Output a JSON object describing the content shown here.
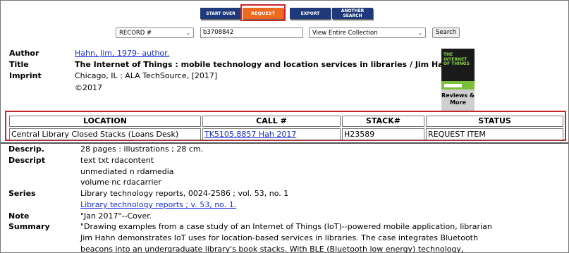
{
  "toolbar": {
    "start_over": "Start Over",
    "request": "Request",
    "export": "Export",
    "another_search": "Another Search"
  },
  "search": {
    "field_select": "RECORD #",
    "query_value": "b3708842",
    "scope_select": "View Entire Collection",
    "search_button": "Search"
  },
  "bib": {
    "author_label": "Author",
    "author_value": "Hahn, Jim, 1979- author.",
    "title_label": "Title",
    "title_value": "The Internet of Things : mobile technology and location services in libraries / Jim Hahn.",
    "imprint_label": "Imprint",
    "imprint_value": "Chicago, IL : ALA TechSource, [2017]",
    "imprint_year": "©2017"
  },
  "cover": {
    "title_lines": "THE INTERNET OF THINGS",
    "reviews_label": "Reviews & More"
  },
  "holdings": {
    "headers": [
      "LOCATION",
      "CALL #",
      "STACK#",
      "STATUS"
    ],
    "row": {
      "location": "Central Library Closed Stacks (Loans Desk)",
      "call_no": "TK5105.8857 Hah 2017",
      "stack": "H23589",
      "status": "REQUEST ITEM"
    }
  },
  "details": {
    "descrip_label": "Descrip.",
    "descrip_value": "28 pages : illustrations ; 28 cm.",
    "descript_label": "Descript",
    "descript_values": [
      "text txt rdacontent",
      "unmediated n rdamedia",
      "volume nc rdacarrier"
    ],
    "series_label": "Series",
    "series_value": "Library technology reports, 0024-2586 ; vol. 53, no. 1",
    "series_link": "Library technology reports ; v. 53, no. 1.",
    "note_label": "Note",
    "note_value": "\"Jan 2017\"--Cover.",
    "summary_label": "Summary",
    "summary_lines": [
      "\"Drawing examples from a case study of an Internet of Things (IoT)--powered mobile application, librarian",
      "Jim Hahn demonstrates IoT uses for location-based services in libraries. The case integrates Bluetooth",
      "beacons into an undergraduate library's book stacks. With BLE (Bluetooth low energy) technology,"
    ]
  }
}
